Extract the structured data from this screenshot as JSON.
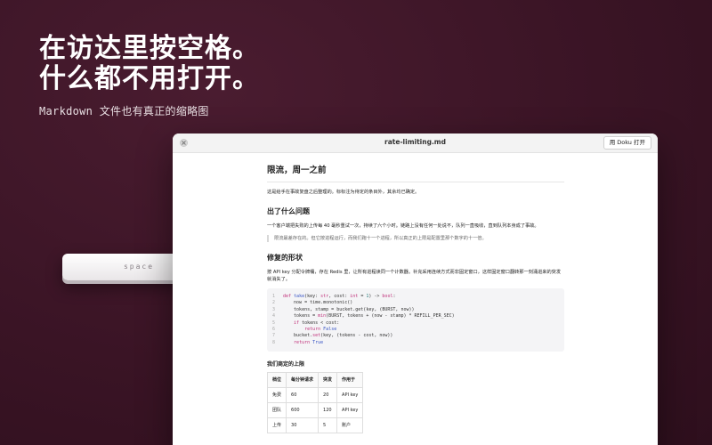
{
  "hero": {
    "line1": "在访达里按空格。",
    "line2": "什么都不用打开。",
    "subtitle": "Markdown 文件也有真正的缩略图"
  },
  "window": {
    "title": "rate-limiting.md",
    "open_button": "用 Doku 打开"
  },
  "keycap": {
    "label": "space"
  },
  "doc": {
    "h1": "限流，周一之前",
    "intro": "这是给手在事故复盘之后整理的。标标注为待定的条目外，其余均已确定。",
    "h2_problem": "出了什么问题",
    "problem_text": "一个客户端把失败的上传每 40 毫秒重试一次，持续了六个小时。链路上没有任何一处说不，队列一直吸收，直到队列本身成了事故。",
    "quote": "限流最差存在的。但它按进程运行，而我们跑十一个进程，所以真正的上限是配置里那个数字的十一倍。",
    "h2_shape": "修复的形状",
    "shape_text": "按 API key 分配令牌桶，存在 Redis 里，让所有进程读同一个计数器。补充采用连续方式而非固定窗口，这样固定窗口翻转那一刻涌进来的突发就消失了。",
    "code": [
      [
        {
          "c": "kw",
          "t": "def "
        },
        {
          "c": "fn",
          "t": "take"
        },
        {
          "c": "txt",
          "t": "(key: "
        },
        {
          "c": "kw",
          "t": "str"
        },
        {
          "c": "txt",
          "t": ", cost: "
        },
        {
          "c": "kw",
          "t": "int"
        },
        {
          "c": "txt",
          "t": " = "
        },
        {
          "c": "num",
          "t": "1"
        },
        {
          "c": "txt",
          "t": ") -> "
        },
        {
          "c": "kw",
          "t": "bool"
        },
        {
          "c": "txt",
          "t": ":"
        }
      ],
      [
        {
          "c": "txt",
          "t": "    now = time.monotonic()"
        }
      ],
      [
        {
          "c": "txt",
          "t": "    tokens, stamp = bucket.get(key, (BURST, now))"
        }
      ],
      [
        {
          "c": "txt",
          "t": "    tokens = "
        },
        {
          "c": "kw",
          "t": "min"
        },
        {
          "c": "txt",
          "t": "(BURST, tokens + (now - stamp) * REFILL_PER_SEC)"
        }
      ],
      [
        {
          "c": "txt",
          "t": "    "
        },
        {
          "c": "kw",
          "t": "if"
        },
        {
          "c": "txt",
          "t": " tokens < cost:"
        }
      ],
      [
        {
          "c": "txt",
          "t": "        "
        },
        {
          "c": "kw",
          "t": "return"
        },
        {
          "c": "txt",
          "t": " "
        },
        {
          "c": "fn",
          "t": "False"
        }
      ],
      [
        {
          "c": "txt",
          "t": "    bucket."
        },
        {
          "c": "kw",
          "t": "set"
        },
        {
          "c": "txt",
          "t": "(key, (tokens - cost, now))"
        }
      ],
      [
        {
          "c": "txt",
          "t": "    "
        },
        {
          "c": "kw",
          "t": "return"
        },
        {
          "c": "txt",
          "t": " "
        },
        {
          "c": "fn",
          "t": "True"
        }
      ]
    ],
    "h3_limits": "我们商定的上限",
    "table": {
      "headers": [
        "档位",
        "每分钟请求",
        "突发",
        "作用于"
      ],
      "rows": [
        [
          "免费",
          "60",
          "20",
          "API key"
        ],
        [
          "团队",
          "600",
          "120",
          "API key"
        ],
        [
          "上传",
          "30",
          "5",
          "账户"
        ]
      ]
    }
  }
}
